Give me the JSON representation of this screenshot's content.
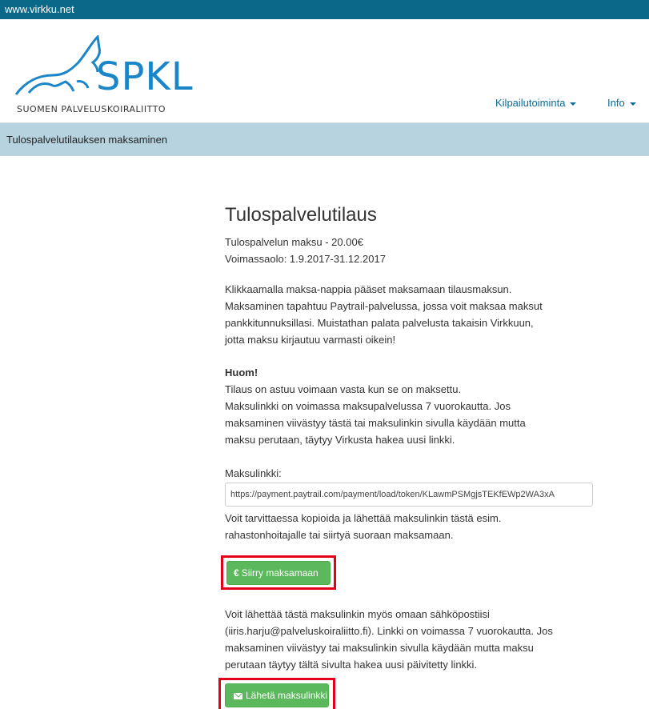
{
  "topbar": {
    "site_link": "www.virkku.net"
  },
  "logo": {
    "word": "SPKL",
    "subtitle": "SUOMEN PALVELUSKOIRALIITTO",
    "brand_color": "#1a86c8"
  },
  "nav": [
    {
      "label": "Kilpailutoiminta"
    },
    {
      "label": "Info"
    }
  ],
  "breadcrumb": {
    "label": "Tulospalvelutilauksen maksaminen"
  },
  "main": {
    "title": "Tulospalvelutilaus",
    "fee": "Tulospalvelun maksu - 20.00€",
    "validity": "Voimassaolo: 1.9.2017-31.12.2017",
    "intro": [
      "Klikkaamalla maksa-nappia pääset maksamaan tilausmaksun.",
      "Maksaminen tapahtuu Paytrail-palvelussa, jossa voit maksaa maksut",
      "pankkitunnuksillasi. Muistathan palata palvelusta takaisin Virkkuun,",
      "jotta maksu kirjautuu varmasti oikein!"
    ],
    "note_heading": "Huom!",
    "note": [
      "Tilaus on astuu voimaan vasta kun se on maksettu.",
      "Maksulinkki on voimassa maksupalvelussa 7 vuorokautta. Jos",
      "maksaminen viivästyy tästä tai maksulinkin sivulla käydään mutta",
      "maksu perutaan, täytyy Virkusta hakea uusi linkki."
    ],
    "link_label": "Maksulinkki:",
    "link_value": "https://payment.paytrail.com/payment/load/token/KLawmPSMgjsTEKfEWp2WA3xA",
    "link_help": [
      "Voit tarvittaessa kopioida ja lähettää maksulinkin tästä esim.",
      "rahastonhoitajalle tai siirtyä suoraan maksamaan."
    ],
    "pay_button": "Siirry maksamaan",
    "email_info": [
      "Voit lähettää tästä maksulinkin myös omaan sähköpostiisi",
      "(iiris.harju@palveluskoiraliitto.fi). Linkki on voimassa 7 vuorokautta. Jos",
      "maksaminen viivästyy tai maksulinkin sivulla käydään mutta maksu",
      "perutaan täytyy tältä sivulta hakea uusi päivitetty linkki."
    ],
    "send_button": "Lähetä maksulinkki"
  },
  "colors": {
    "topbar": "#0a6888",
    "breadcrumb_bg": "#b7d3e0",
    "button_green": "#5cb85c",
    "highlight_red": "#e3001b"
  }
}
